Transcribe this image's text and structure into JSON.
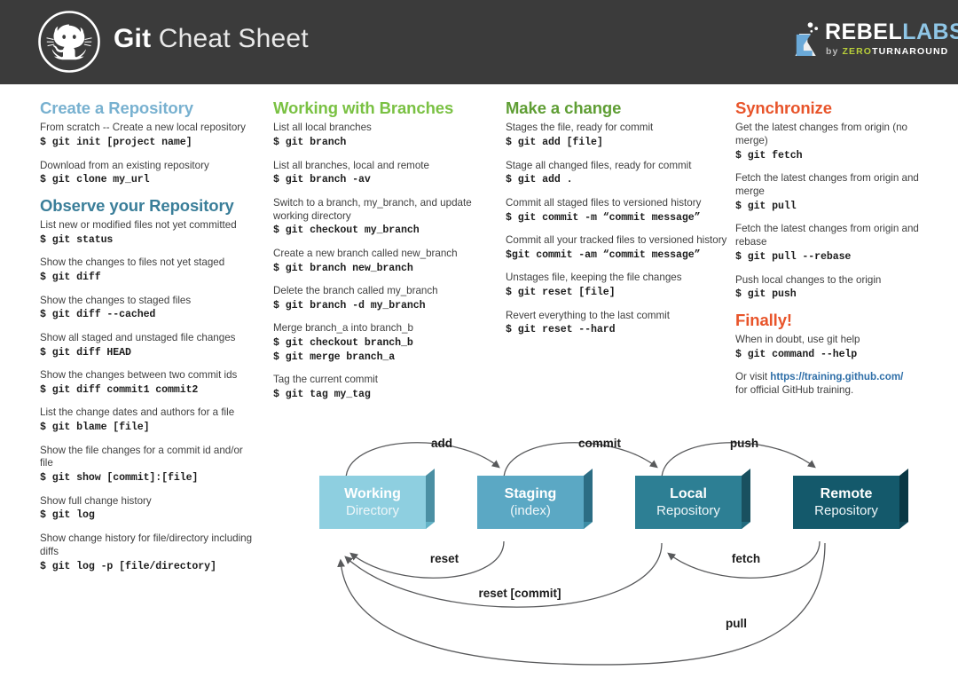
{
  "header": {
    "title_bold": "Git",
    "title_light": " Cheat Sheet",
    "octocat_icon": "octocat-icon",
    "logo": {
      "flask_icon": "flask-icon",
      "word_rebel": "REBEL",
      "word_labs": "LABS",
      "sub_by": "by ",
      "sub_zero": "ZERO",
      "sub_turnaround": "TURNAROUND"
    }
  },
  "colors": {
    "header_bg": "#3b3b3b",
    "light_blue": "#78b1d0",
    "dark_blue": "#3a7e99",
    "green": "#7ac143",
    "olive": "#5f9e34",
    "orange": "#e8542a",
    "link": "#2f6fa8",
    "box_working": "#8ecfe0",
    "box_staging": "#5ba8c4",
    "box_local": "#2d7f94",
    "box_remote": "#14596b",
    "arrow": "#58595b"
  },
  "columns": [
    {
      "id": "col1",
      "sections": [
        {
          "heading": "Create a Repository",
          "heading_color": "light_blue",
          "entries": [
            {
              "desc": "From scratch -- Create a new local repository",
              "cmds": [
                "$ git init [project name]"
              ]
            },
            {
              "desc": "Download from an existing repository",
              "cmds": [
                "$ git clone my_url"
              ]
            }
          ]
        },
        {
          "heading": "Observe your Repository",
          "heading_color": "dark_blue",
          "entries": [
            {
              "desc": "List new or modified files not yet committed",
              "cmds": [
                "$ git status"
              ]
            },
            {
              "desc": "Show the changes to files not yet staged",
              "cmds": [
                "$ git diff"
              ]
            },
            {
              "desc": "Show the changes to staged files",
              "cmds": [
                "$ git diff --cached"
              ]
            },
            {
              "desc": "Show all staged and unstaged file changes",
              "cmds": [
                "$ git diff HEAD"
              ]
            },
            {
              "desc": "Show the changes between two commit ids",
              "cmds": [
                "$ git diff commit1 commit2"
              ]
            },
            {
              "desc": "List the change dates and authors for a file",
              "cmds": [
                "$ git blame [file]"
              ]
            },
            {
              "desc": "Show the file changes for a commit id and/or file",
              "cmds": [
                "$ git show [commit]:[file]"
              ]
            },
            {
              "desc": "Show full change history",
              "cmds": [
                "$ git log"
              ]
            },
            {
              "desc": "Show change history for file/directory including diffs",
              "cmds": [
                "$ git log -p [file/directory]"
              ]
            }
          ]
        }
      ]
    },
    {
      "id": "col2",
      "sections": [
        {
          "heading": "Working with Branches",
          "heading_color": "green",
          "entries": [
            {
              "desc": "List all local branches",
              "cmds": [
                "$ git branch"
              ]
            },
            {
              "desc": "List all branches, local and remote",
              "cmds": [
                "$ git branch -av"
              ]
            },
            {
              "desc": "Switch to a branch, my_branch, and update working directory",
              "cmds": [
                "$ git checkout my_branch"
              ]
            },
            {
              "desc": "Create a new branch called new_branch",
              "cmds": [
                "$ git branch new_branch"
              ]
            },
            {
              "desc": "Delete the branch called my_branch",
              "cmds": [
                "$ git branch -d my_branch"
              ]
            },
            {
              "desc": "Merge branch_a into branch_b",
              "cmds": [
                "$ git checkout branch_b",
                "$ git merge branch_a"
              ]
            },
            {
              "desc": "Tag the current commit",
              "cmds": [
                "$ git tag my_tag"
              ]
            }
          ]
        }
      ]
    },
    {
      "id": "col3",
      "sections": [
        {
          "heading": "Make a change",
          "heading_color": "olive",
          "entries": [
            {
              "desc": "Stages the file, ready for commit",
              "cmds": [
                "$ git add [file]"
              ]
            },
            {
              "desc": "Stage all changed files, ready for commit",
              "cmds": [
                "$ git add ."
              ]
            },
            {
              "desc": "Commit all staged files to versioned history",
              "cmds": [
                "$ git commit -m “commit message”"
              ]
            },
            {
              "desc": "Commit all your tracked files to versioned history",
              "cmds": [
                "$git commit -am “commit message”"
              ]
            },
            {
              "desc": "Unstages file, keeping the file changes",
              "cmds": [
                "$ git reset [file]"
              ]
            },
            {
              "desc": "Revert everything to the last commit",
              "cmds": [
                "$ git reset --hard"
              ]
            }
          ]
        }
      ]
    },
    {
      "id": "col4",
      "sections": [
        {
          "heading": "Synchronize",
          "heading_color": "orange",
          "entries": [
            {
              "desc": "Get the latest changes from origin (no merge)",
              "cmds": [
                "$ git fetch"
              ]
            },
            {
              "desc": "Fetch the latest changes from origin and merge",
              "cmds": [
                "$ git pull"
              ]
            },
            {
              "desc": "Fetch the latest changes from origin and rebase",
              "cmds": [
                "$ git pull --rebase"
              ]
            },
            {
              "desc": "Push local changes to the origin",
              "cmds": [
                "$ git push"
              ]
            }
          ]
        },
        {
          "heading": "Finally!",
          "heading_color": "orange",
          "entries": [
            {
              "desc": "When in doubt, use git help",
              "cmds": [
                "$ git command --help"
              ]
            }
          ],
          "footer": {
            "pre": "Or visit ",
            "link": "https://training.github.com/",
            "post": "for official GitHub training."
          }
        }
      ]
    }
  ],
  "diagram": {
    "boxes": [
      {
        "title": "Working",
        "subtitle": "Directory"
      },
      {
        "title": "Staging",
        "subtitle": "(index)"
      },
      {
        "title": "Local",
        "subtitle": "Repository"
      },
      {
        "title": "Remote",
        "subtitle": "Repository"
      }
    ],
    "arrows": [
      {
        "label": "add"
      },
      {
        "label": "commit"
      },
      {
        "label": "push"
      },
      {
        "label": "reset"
      },
      {
        "label": "fetch"
      },
      {
        "label": "reset [commit]"
      },
      {
        "label": "pull"
      }
    ]
  }
}
